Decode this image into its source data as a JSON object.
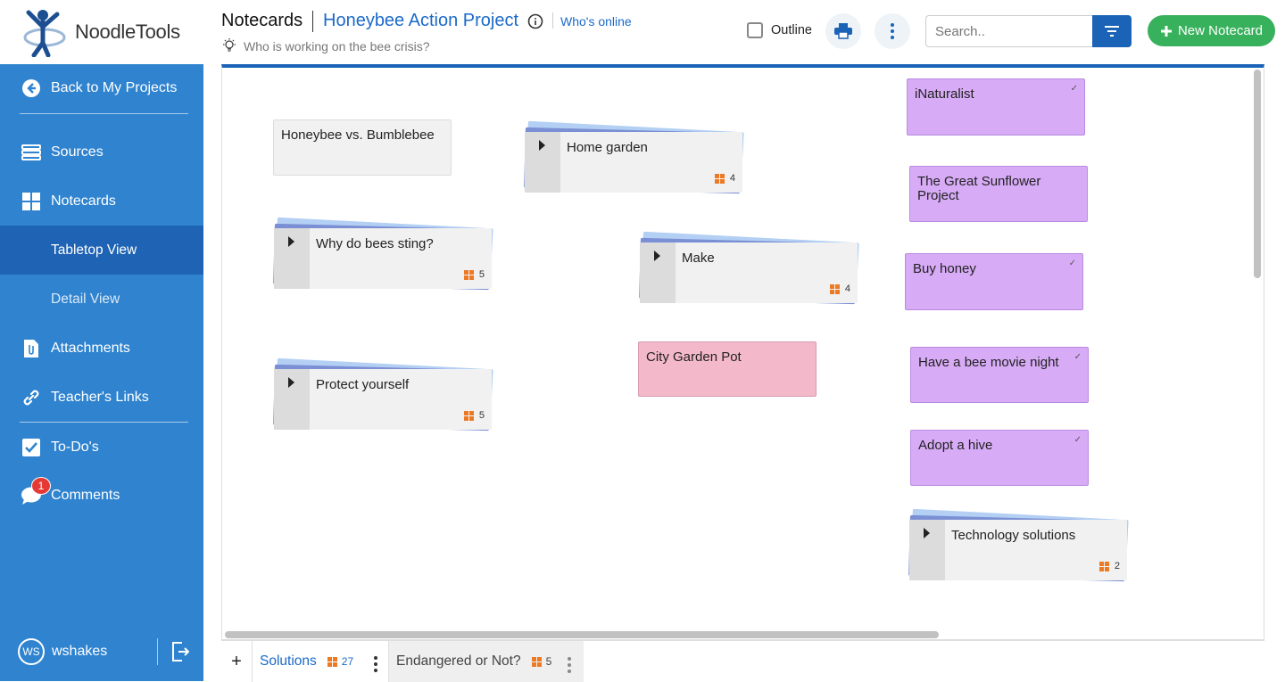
{
  "app": {
    "logo_text": "NoodleTools"
  },
  "sidebar": {
    "back": "Back to My Projects",
    "items": [
      {
        "label": "Sources"
      },
      {
        "label": "Notecards"
      },
      {
        "label": "Tabletop View"
      },
      {
        "label": "Detail View"
      },
      {
        "label": "Attachments"
      },
      {
        "label": "Teacher's Links"
      },
      {
        "label": "To-Do's"
      },
      {
        "label": "Comments"
      }
    ],
    "comments_badge": "1",
    "user_initials": "WS",
    "user_name": "wshakes"
  },
  "header": {
    "section": "Notecards",
    "project": "Honeybee Action Project",
    "whos_online": "Who's online",
    "question": "Who is working on the bee crisis?",
    "outline_label": "Outline",
    "search_placeholder": "Search..",
    "new_notecard": "New Notecard"
  },
  "cards": {
    "honeybee_vs": "Honeybee vs. Bumblebee",
    "home_garden": {
      "title": "Home garden",
      "count": "4"
    },
    "why_sting": {
      "title": "Why do bees sting?",
      "count": "5"
    },
    "make": {
      "title": "Make",
      "count": "4"
    },
    "protect": {
      "title": "Protect yourself",
      "count": "5"
    },
    "city_garden": "City Garden Pot",
    "inaturalist": "iNaturalist",
    "sunflower": "The Great Sunflower Project",
    "buy_honey": "Buy honey",
    "movie_night": "Have a bee movie night",
    "adopt": "Adopt a hive",
    "tech": {
      "title": "Technology solutions",
      "count": "2"
    }
  },
  "tabs": [
    {
      "label": "Solutions",
      "count": "27"
    },
    {
      "label": "Endangered or Not?",
      "count": "5"
    }
  ],
  "colors": {
    "sidebar": "#2f83cf",
    "active": "#1f63b4",
    "accent": "#1b63b6",
    "new_btn": "#38b15c",
    "purple_card": "#d7abf6",
    "pink_card": "#f4b8cb"
  }
}
